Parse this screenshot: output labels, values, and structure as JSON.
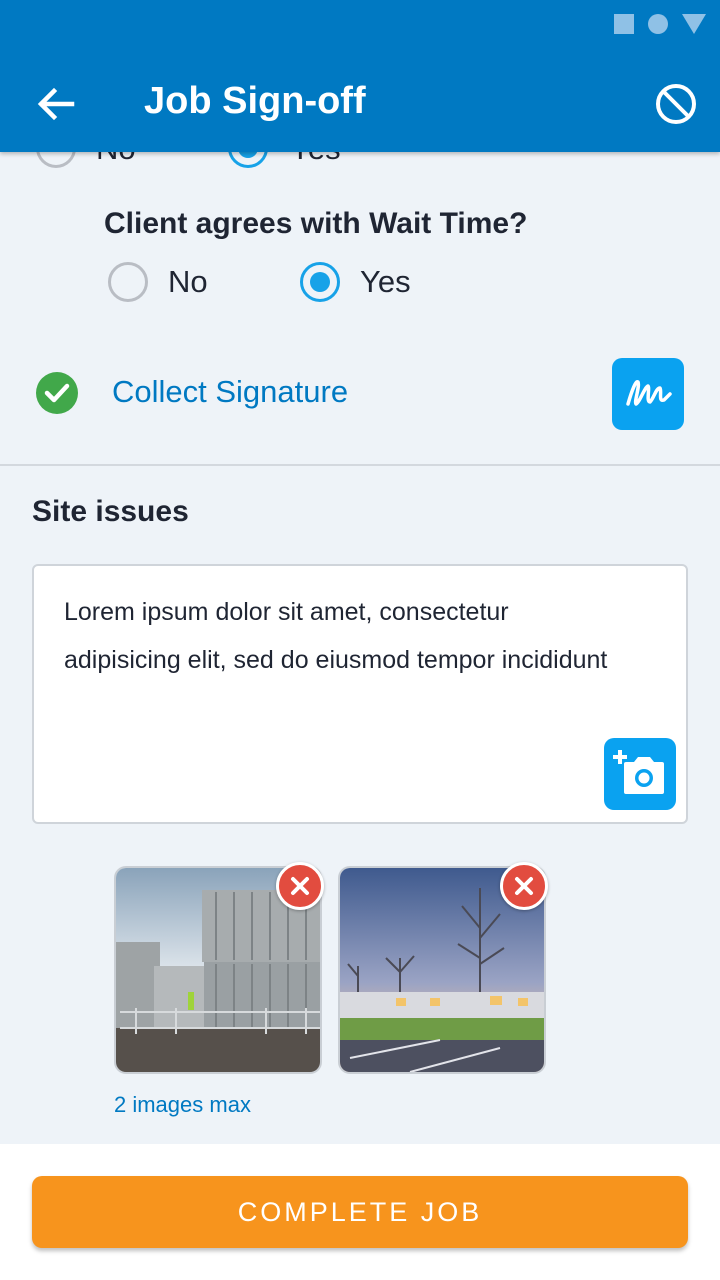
{
  "app_bar": {
    "title": "Job Sign-off",
    "back_icon": "arrow-left-icon",
    "cancel_icon": "block-icon",
    "color": "#0079c2"
  },
  "status_bar": {
    "icons": [
      "square-icon",
      "circle-icon",
      "triangle-icon"
    ]
  },
  "previous_question": {
    "options": [
      {
        "label": "No",
        "selected": false
      },
      {
        "label": "Yes",
        "selected": true
      }
    ]
  },
  "wait_time_question": {
    "label": "Client agrees with Wait Time?",
    "options": [
      {
        "label": "No",
        "selected": false
      },
      {
        "label": "Yes",
        "selected": true
      }
    ]
  },
  "signature": {
    "label": "Collect Signature",
    "status_icon": "check-circle-icon",
    "button_icon": "signature-icon"
  },
  "site_issues": {
    "title": "Site issues",
    "text": "Lorem ipsum dolor sit amet, consectetur adipisicing elit, sed do eiusmod tempor incididunt",
    "camera_icon": "add-photo-icon",
    "images": [
      {
        "name": "portable-cabins-photo"
      },
      {
        "name": "site-at-dusk-photo"
      }
    ],
    "max_note": "2 images max"
  },
  "footer": {
    "complete_label": "COMPLETE JOB",
    "button_color": "#f7941d"
  }
}
